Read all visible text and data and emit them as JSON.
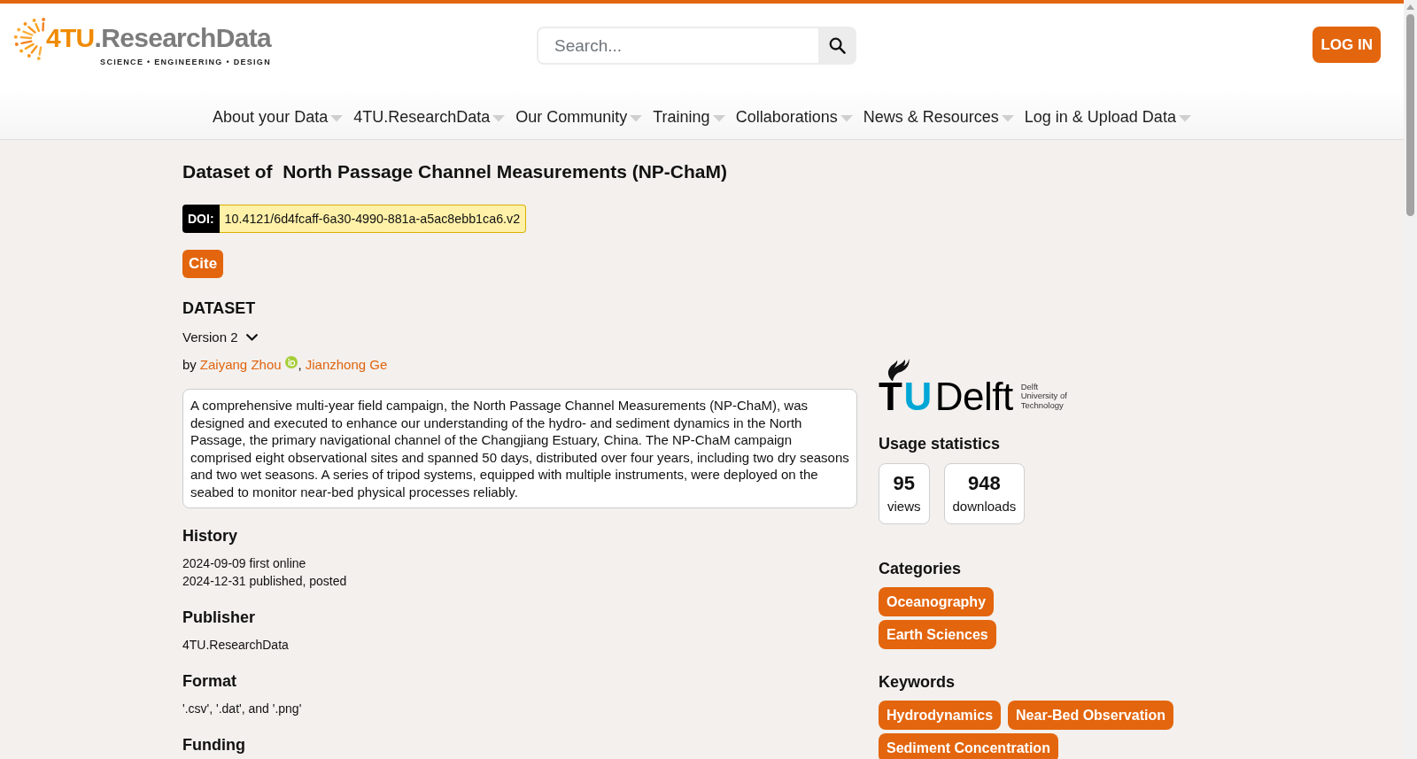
{
  "header": {
    "logo": {
      "wordmark_accent": "4TU",
      "wordmark_rest": ".ResearchData",
      "tagline": "SCIENCE • ENGINEERING • DESIGN"
    },
    "search": {
      "placeholder": "Search..."
    },
    "login_button": "LOG IN"
  },
  "nav": {
    "items": [
      {
        "label": "About your Data",
        "dropdown": true
      },
      {
        "label": "4TU.ResearchData",
        "dropdown": true
      },
      {
        "label": "Our Community",
        "dropdown": true
      },
      {
        "label": "Training",
        "dropdown": true
      },
      {
        "label": "Collaborations",
        "dropdown": true
      },
      {
        "label": "News & Resources",
        "dropdown": true
      },
      {
        "label": "Log in & Upload Data",
        "dropdown": true
      }
    ]
  },
  "dataset": {
    "title": "Dataset of  North Passage Channel Measurements (NP-ChaM)",
    "doi": {
      "label": "DOI:",
      "value": "10.4121/6d4fcaff-6a30-4990-881a-a5ac8ebb1ca6.v2"
    },
    "cite_button": "Cite",
    "type_label": "DATASET",
    "version": "Version 2",
    "byline": {
      "prefix": "by",
      "separator": ",",
      "authors": [
        {
          "name": "Zaiyang Zhou",
          "orcid": true
        },
        {
          "name": "Jianzhong Ge",
          "orcid": false
        }
      ]
    },
    "description": "A comprehensive multi-year field campaign, the North Passage Channel Measurements (NP-ChaM), was designed and executed to enhance our understanding of the hydro- and sediment dynamics in the North Passage, the primary navigational channel of the Changjiang Estuary, China. The NP-ChaM campaign comprised eight observational sites and spanned 50 days, distributed over four years, including two dry seasons and two wet seasons. A series of tripod systems, equipped with multiple instruments, were deployed on the seabed to monitor near-bed physical processes reliably.",
    "sections": [
      {
        "heading": "History",
        "lines": [
          "2024-09-09 first online",
          "2024-12-31 published, posted"
        ]
      },
      {
        "heading": "Publisher",
        "lines": [
          "4TU.ResearchData"
        ]
      },
      {
        "heading": "Format",
        "lines": [
          "'.csv', '.dat', and '.png'"
        ]
      },
      {
        "heading": "Funding"
      }
    ]
  },
  "sidebar": {
    "institution_logo": {
      "wordmark": [
        "T",
        "U",
        "Delft"
      ],
      "caption": [
        "Delft",
        "University of",
        "Technology"
      ]
    },
    "usage": {
      "heading": "Usage statistics",
      "stats": [
        {
          "value": "95",
          "label": "views"
        },
        {
          "value": "948",
          "label": "downloads"
        }
      ]
    },
    "categories": {
      "heading": "Categories",
      "tags": [
        "Oceanography",
        "Earth Sciences"
      ]
    },
    "keywords": {
      "heading": "Keywords",
      "tags": [
        "Hydrodynamics",
        "Near-Bed Observation",
        "Sediment Concentration"
      ]
    }
  }
}
